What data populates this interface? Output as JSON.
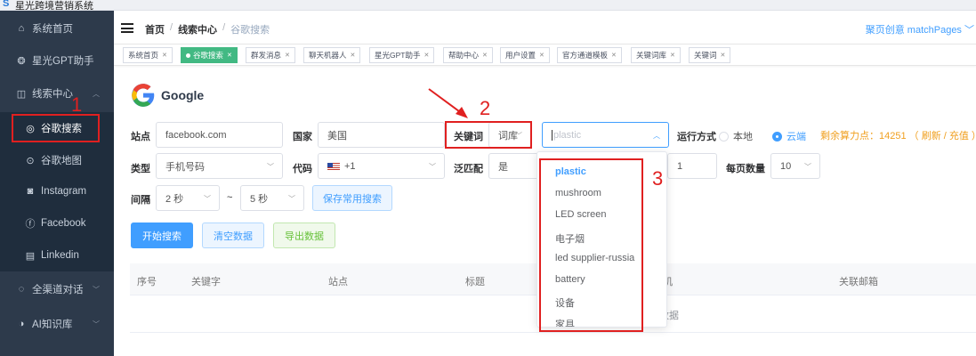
{
  "app": {
    "title": "星光跨境营销系统",
    "logo": "S"
  },
  "sidebar": {
    "items": [
      {
        "label": "系统首页",
        "icon": "home-icon",
        "glyph": "⌂"
      },
      {
        "label": "星光GPT助手",
        "icon": "openai-icon",
        "glyph": "❂"
      },
      {
        "label": "线索中心",
        "icon": "clue-icon",
        "glyph": "◫",
        "arrow": "︿"
      },
      {
        "label": "谷歌搜索",
        "icon": "google-icon",
        "glyph": "◎"
      },
      {
        "label": "谷歌地图",
        "icon": "map-pin-icon",
        "glyph": "⊙"
      },
      {
        "label": "Instagram",
        "icon": "instagram-icon",
        "glyph": "◙"
      },
      {
        "label": "Facebook",
        "icon": "facebook-icon",
        "glyph": "ⓕ"
      },
      {
        "label": "Linkedin",
        "icon": "linkedin-icon",
        "glyph": "▤"
      },
      {
        "label": "全渠道对话",
        "icon": "chat-icon",
        "glyph": "◌",
        "arrow": "﹀"
      },
      {
        "label": "AI知识库",
        "icon": "knowledge-icon",
        "glyph": "◑",
        "arrow": "﹀"
      }
    ]
  },
  "header": {
    "breadcrumb": [
      "首页",
      "线索中心",
      "谷歌搜索"
    ],
    "separator": "/",
    "user": "聚页创意 matchPages ﹀"
  },
  "tags": [
    {
      "label": "系统首页",
      "active": false
    },
    {
      "label": "谷歌搜索",
      "active": true
    },
    {
      "label": "群发消息",
      "active": false
    },
    {
      "label": "聊天机器人",
      "active": false
    },
    {
      "label": "星光GPT助手",
      "active": false
    },
    {
      "label": "帮助中心",
      "active": false
    },
    {
      "label": "用户设置",
      "active": false
    },
    {
      "label": "官方通道模板",
      "active": false
    },
    {
      "label": "关键词库",
      "active": false
    },
    {
      "label": "关键词",
      "active": false
    }
  ],
  "brand": {
    "name": "Google"
  },
  "form": {
    "site_label": "站点",
    "site_value": "facebook.com",
    "country_label": "国家",
    "country_value": "美国",
    "keyword_label": "关键词",
    "keyword_source": "词库",
    "keyword_placeholder": "plastic",
    "run_label": "运行方式",
    "run_local": "本地",
    "run_cloud": "云端",
    "points_text": "剩余算力点：14251 （ 刷新 / 充值 ）",
    "type_label": "类型",
    "type_value": "手机号码",
    "code_label": "代码",
    "code_value": "+1",
    "fuzzy_label": "泛匹配",
    "fuzzy_value": "是",
    "page_value": "1",
    "per_page_label": "每页数量",
    "per_page_value": "10",
    "interval_label": "间隔",
    "interval_from": "2 秒",
    "interval_sep": "~",
    "interval_to": "5 秒",
    "save_search": "保存常用搜索"
  },
  "actions": {
    "start": "开始搜索",
    "clear": "清空数据",
    "export": "导出数据"
  },
  "table": {
    "columns": [
      "序号",
      "关键字",
      "站点",
      "标题",
      "关联邮箱"
    ],
    "partial_col": "机",
    "empty": "数据"
  },
  "dropdown": {
    "options": [
      "plastic",
      "mushroom",
      "LED screen",
      "电子烟",
      "led supplier-russia",
      "battery",
      "设备",
      "家具"
    ],
    "selected": "plastic"
  },
  "annotations": {
    "n1": "1",
    "n2": "2",
    "n3": "3",
    "color": "#e02020"
  },
  "colors": {
    "sidebar_bg": "#2d3a4b",
    "primary": "#409eff",
    "tag_active": "#42b983",
    "warn": "#f0a020"
  }
}
